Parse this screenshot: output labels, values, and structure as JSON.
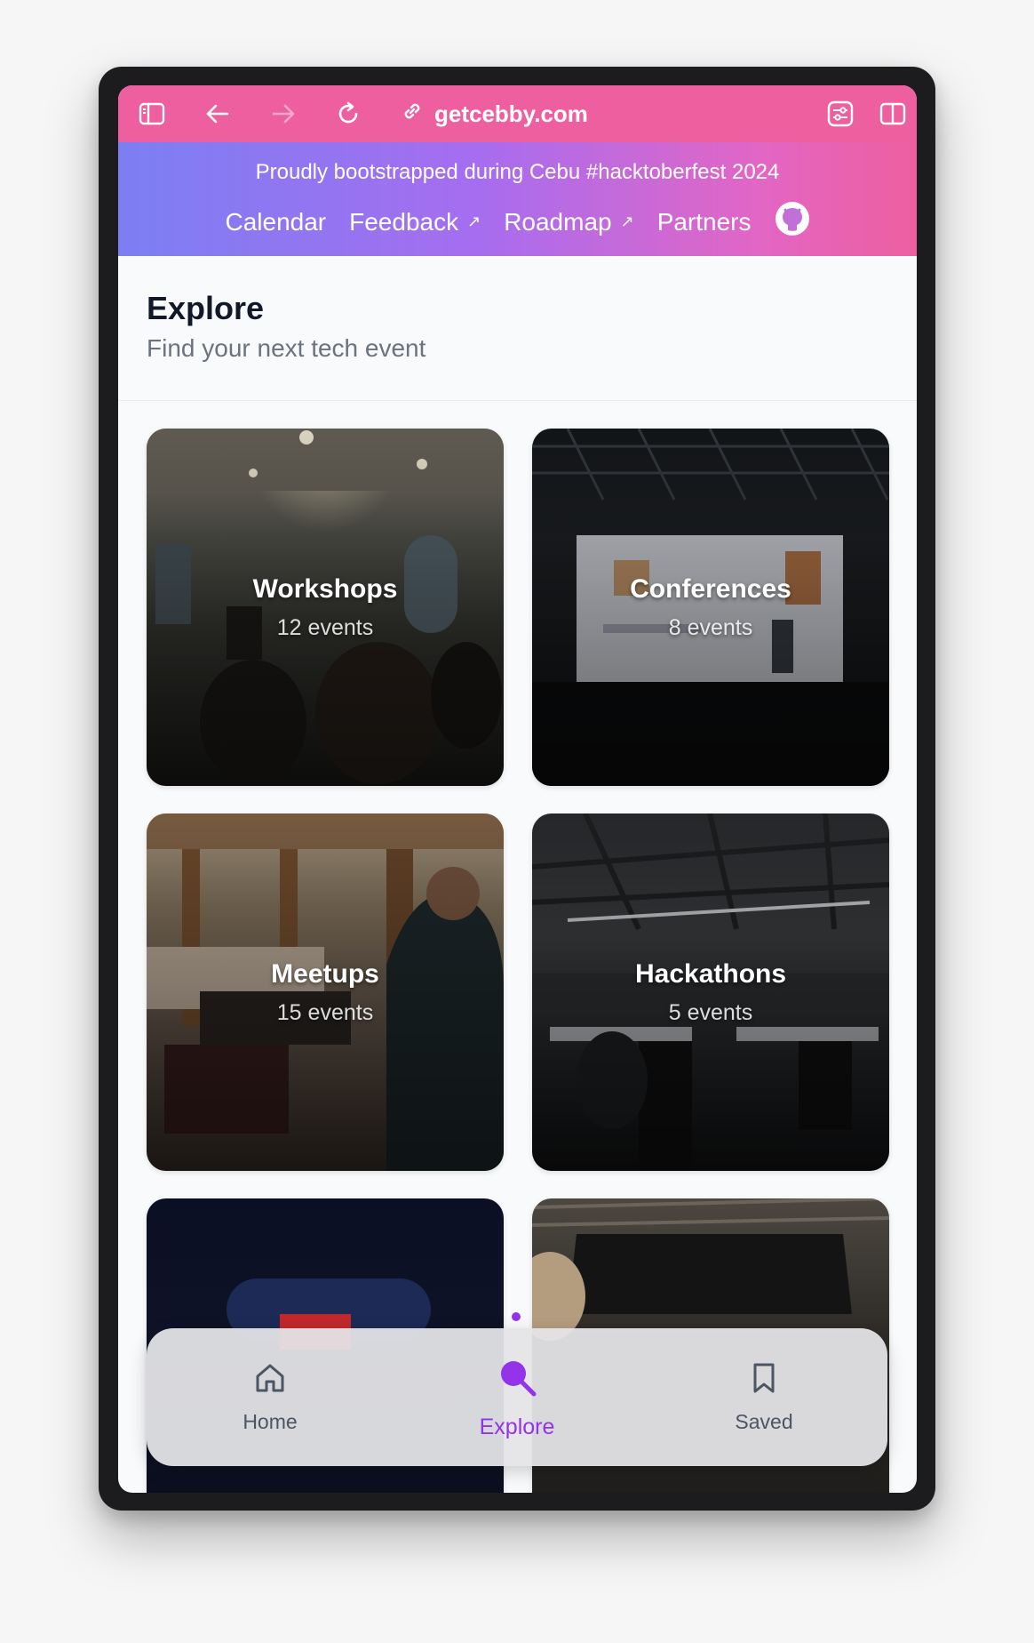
{
  "browser": {
    "url": "getcebby.com",
    "icons": [
      "sidebar-icon",
      "back-arrow-icon",
      "forward-arrow-icon",
      "reload-icon",
      "link-icon",
      "settings-sliders-icon",
      "split-view-icon"
    ]
  },
  "banner": {
    "text": "Proudly bootstrapped during Cebu #hacktoberfest 2024",
    "links": [
      "Calendar",
      "Feedback",
      "Roadmap",
      "Partners"
    ],
    "external_glyph": "↗"
  },
  "page": {
    "title": "Explore",
    "subtitle": "Find your next tech event"
  },
  "categories": [
    {
      "name": "Workshops",
      "count": "12 events"
    },
    {
      "name": "Conferences",
      "count": "8 events"
    },
    {
      "name": "Meetups",
      "count": "15 events"
    },
    {
      "name": "Hackathons",
      "count": "5 events"
    }
  ],
  "bottom_nav": {
    "items": [
      {
        "label": "Home",
        "icon": "home-icon"
      },
      {
        "label": "Explore",
        "icon": "search-icon",
        "active": true
      },
      {
        "label": "Saved",
        "icon": "bookmark-icon"
      }
    ]
  },
  "colors": {
    "browser_bar": "#ee5f9f",
    "accent": "#9333ea",
    "banner_start": "#7c7ff2",
    "banner_end": "#ee5f9f"
  }
}
